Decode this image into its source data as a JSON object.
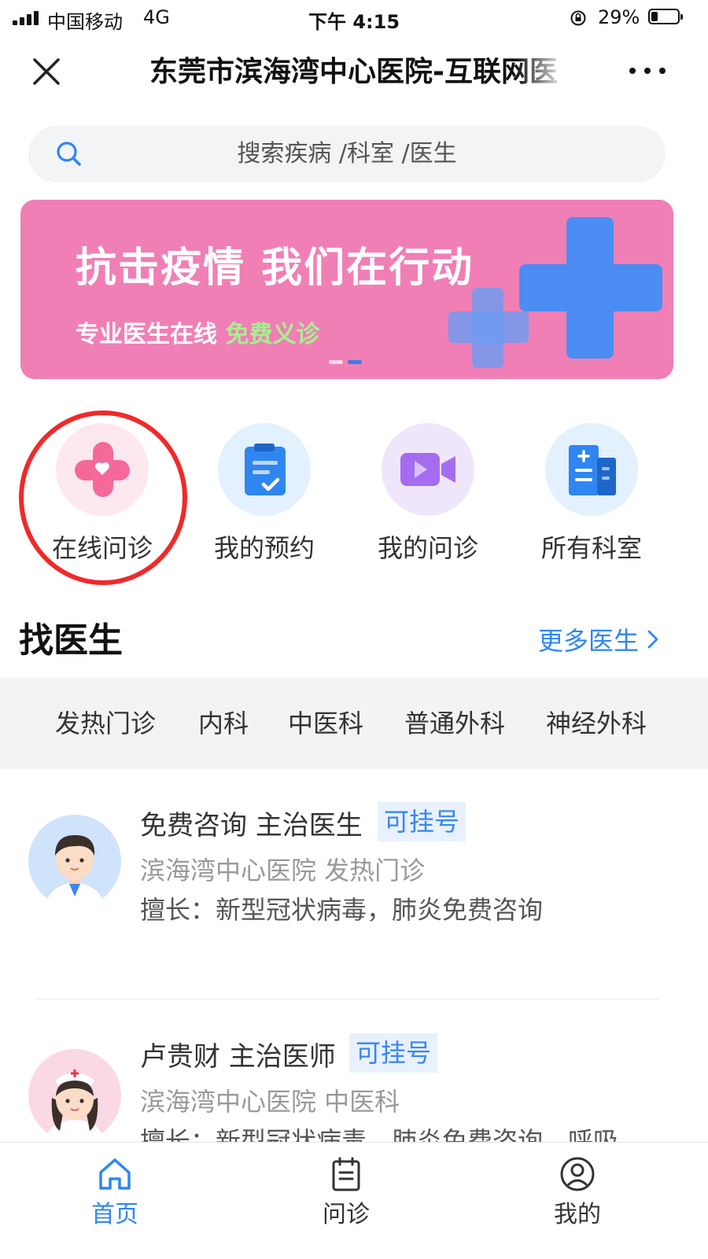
{
  "status_bar": {
    "carrier": "中国移动",
    "network": "4G",
    "time": "下午 4:15",
    "battery": "29%"
  },
  "nav": {
    "title": "东莞市滨海湾中心医院-互联网医"
  },
  "search": {
    "placeholder": "搜索疾病 /科室 /医生"
  },
  "banner": {
    "title": "抗击疫情 我们在行动",
    "subtitle_white": "专业医生在线",
    "subtitle_green": "免费义诊"
  },
  "quick": [
    {
      "label": "在线问诊",
      "icon": "heart-cross-icon"
    },
    {
      "label": "我的预约",
      "icon": "clipboard-check-icon"
    },
    {
      "label": "我的问诊",
      "icon": "video-icon"
    },
    {
      "label": "所有科室",
      "icon": "building-icon"
    }
  ],
  "find_doctor": {
    "title": "找医生",
    "more": "更多医生"
  },
  "tabs": [
    "发热门诊",
    "内科",
    "中医科",
    "普通外科",
    "神经外科"
  ],
  "doctors": [
    {
      "name": "免费咨询 主治医生",
      "badge": "可挂号",
      "hospital": "滨海湾中心医院 发热门诊",
      "skill": "擅长：新型冠状病毒，肺炎免费咨询"
    },
    {
      "name": "卢贵财 主治医师",
      "badge": "可挂号",
      "hospital": "滨海湾中心医院 中医科",
      "skill": "擅长：新型冠状病毒，肺炎免费咨询，呼吸"
    }
  ],
  "bottom_nav": [
    {
      "label": "首页",
      "icon": "home-icon",
      "active": true
    },
    {
      "label": "问诊",
      "icon": "clipboard-icon",
      "active": false
    },
    {
      "label": "我的",
      "icon": "user-icon",
      "active": false
    }
  ],
  "colors": {
    "accent": "#2f86f0",
    "banner": "#f07fb6",
    "annotation_red": "#f02a2a"
  }
}
